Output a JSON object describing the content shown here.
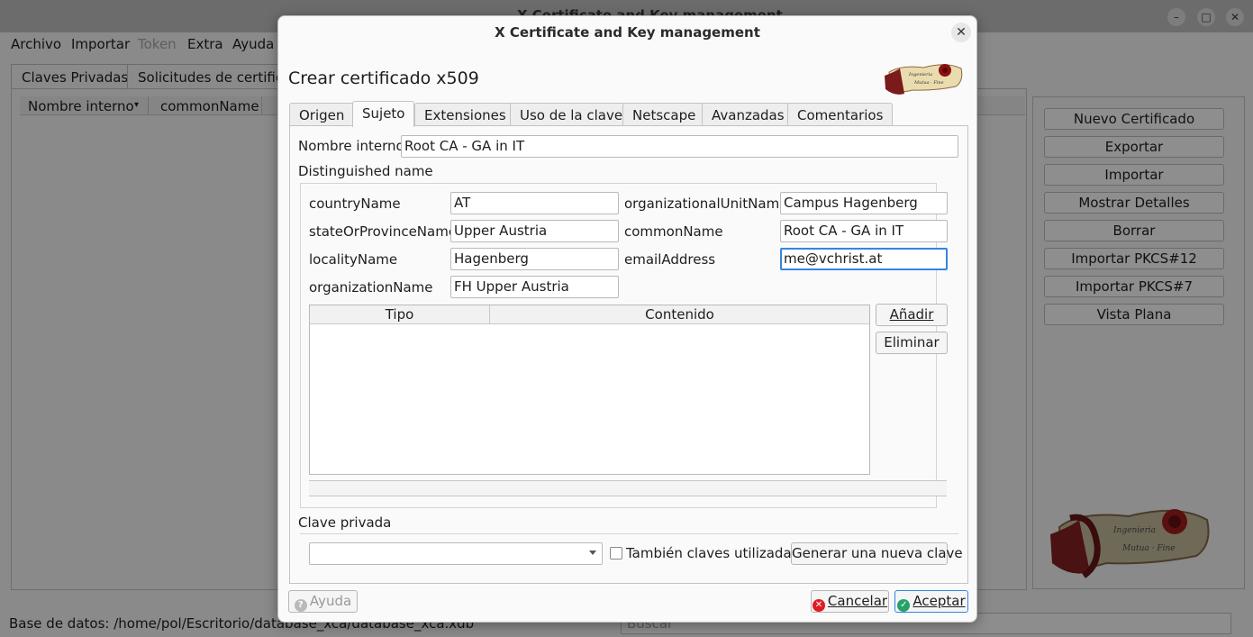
{
  "main_window": {
    "title": "X Certificate and Key management",
    "menu": [
      "Archivo",
      "Importar",
      "Token",
      "Extra",
      "Ayuda"
    ],
    "tabs": [
      "Claves Privadas",
      "Solicitudes de certificado"
    ],
    "list_columns": [
      "Nombre interno",
      "commonName"
    ],
    "side_buttons": [
      "Nuevo Certificado",
      "Exportar",
      "Importar",
      "Mostrar Detalles",
      "Borrar",
      "Importar PKCS#12",
      "Importar PKCS#7",
      "Vista Plana"
    ],
    "status": "Base de datos: /home/pol/Escritorio/database_xca/database_xca.xdb",
    "search_placeholder": "Buscar"
  },
  "dialog": {
    "title": "X Certificate and Key management",
    "close_glyph": "✕",
    "heading": "Crear certificado x509",
    "tabs": [
      "Origen",
      "Sujeto",
      "Extensiones",
      "Uso de la clave",
      "Netscape",
      "Avanzadas",
      "Comentarios"
    ],
    "active_tab": "Sujeto",
    "internal_name_label": "Nombre interno",
    "internal_name_value": "Root CA - GA in IT",
    "dn_group_label": "Distinguished name",
    "dn_fields": {
      "countryName": {
        "label": "countryName",
        "value": "AT"
      },
      "stateOrProvinceName": {
        "label": "stateOrProvinceName",
        "value": "Upper Austria"
      },
      "localityName": {
        "label": "localityName",
        "value": "Hagenberg"
      },
      "organizationName": {
        "label": "organizationName",
        "value": "FH Upper Austria"
      },
      "organizationalUnitName": {
        "label": "organizationalUnitName",
        "value": "Campus Hagenberg"
      },
      "commonName": {
        "label": "commonName",
        "value": "Root CA - GA in IT"
      },
      "emailAddress": {
        "label": "emailAddress",
        "value": "me@vchrist.at"
      }
    },
    "table_columns": [
      "Tipo",
      "Contenido"
    ],
    "add_button": "Añadir",
    "remove_button": "Eliminar",
    "private_key_label": "Clave privada",
    "private_key_value": "",
    "used_keys_checkbox": "También claves utilizadas",
    "generate_key_button": "Generar una nueva clave",
    "help_button": "Ayuda",
    "cancel_button": "Cancelar",
    "accept_button": "Aceptar"
  },
  "colors": {
    "focus": "#3584e4",
    "cancel_icon": "#e01b24",
    "accept_icon": "#26a269",
    "seal_paper": "#e8d8a0",
    "seal_ribbon": "#7a1a1a"
  }
}
